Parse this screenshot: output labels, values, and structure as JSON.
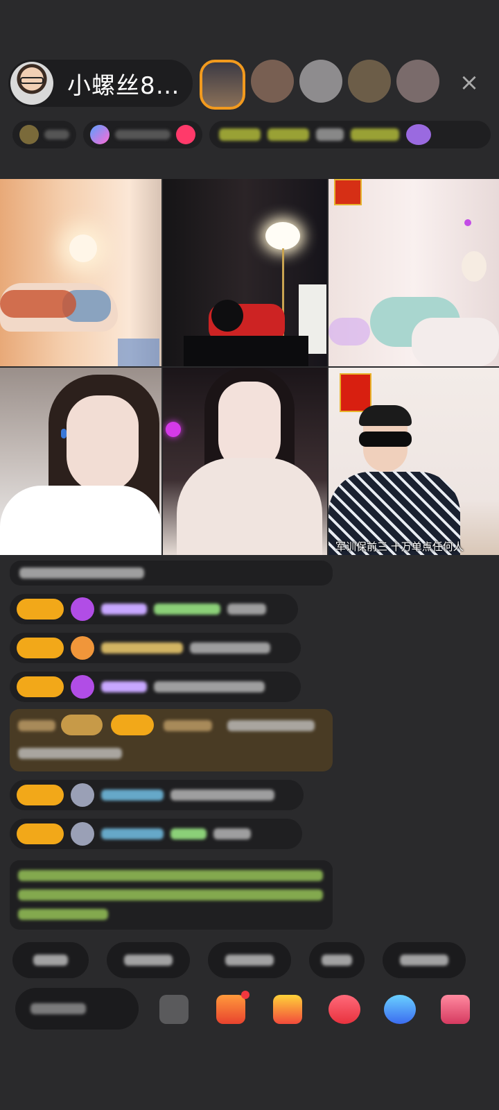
{
  "host": {
    "name": "小螺丝8…",
    "avatar_icon": "host-avatar-icon"
  },
  "top_bar": {
    "viewer_avatars": [
      "viewer-avatar-1",
      "viewer-avatar-2",
      "viewer-avatar-3",
      "viewer-avatar-4",
      "viewer-avatar-5"
    ],
    "close_icon": "×",
    "accent_color": "#f29a1e"
  },
  "video_tiles": [
    {
      "id": "tile-1",
      "caption": ""
    },
    {
      "id": "tile-2",
      "caption": ""
    },
    {
      "id": "tile-3",
      "caption": ""
    },
    {
      "id": "tile-4",
      "caption": ""
    },
    {
      "id": "tile-5",
      "caption": ""
    },
    {
      "id": "tile-6",
      "caption": "军训保前三 十万单点任何人"
    }
  ],
  "colors": {
    "badge": "#f2a819",
    "gift_message_bg": "#493b24",
    "green_text": "#9ccc5a",
    "background": "#2a2a2c"
  }
}
